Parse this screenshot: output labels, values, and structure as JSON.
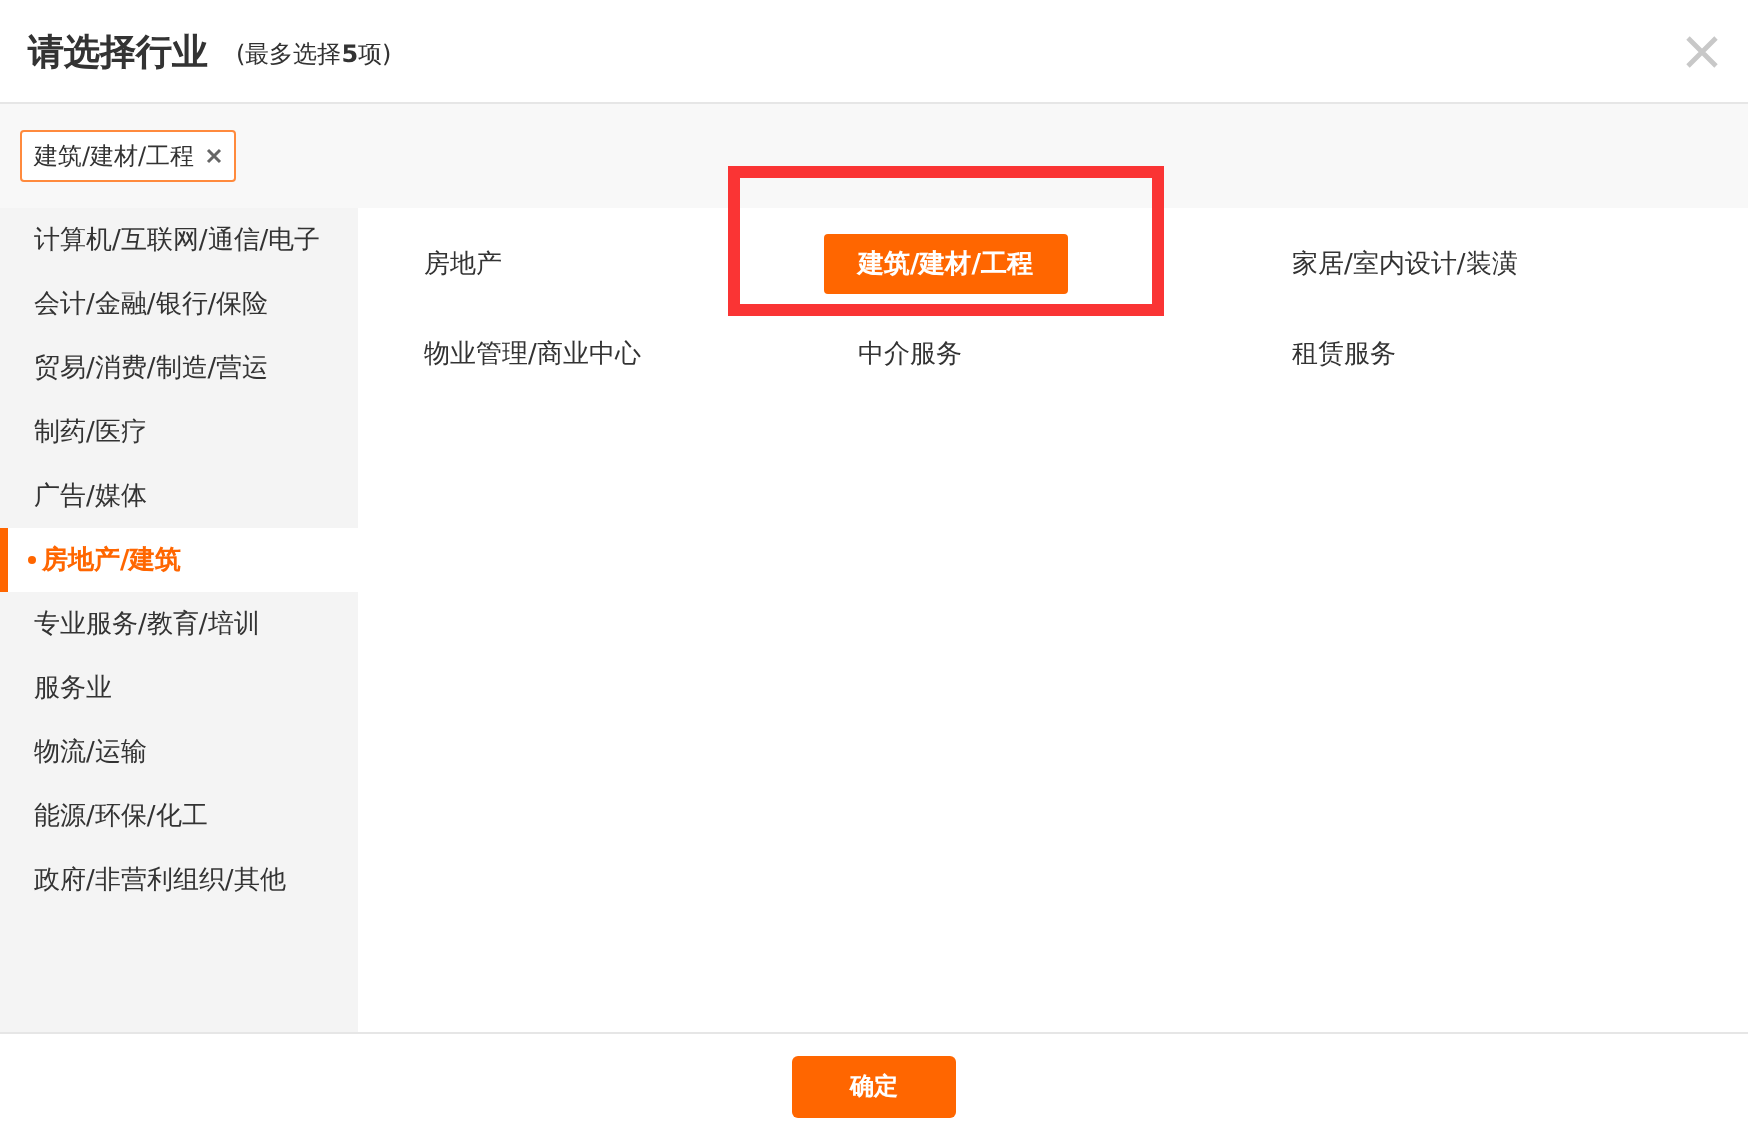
{
  "dialog": {
    "title": "请选择行业",
    "subtitle": "(最多选择**5**项)"
  },
  "chosen_tags": [
    {
      "label": "建筑/建材/工程"
    }
  ],
  "categories": [
    {
      "label": "计算机/互联网/通信/电子",
      "selected": false
    },
    {
      "label": "会计/金融/银行/保险",
      "selected": false
    },
    {
      "label": "贸易/消费/制造/营运",
      "selected": false
    },
    {
      "label": "制药/医疗",
      "selected": false
    },
    {
      "label": "广告/媒体",
      "selected": false
    },
    {
      "label": "房地产/建筑",
      "selected": true
    },
    {
      "label": "专业服务/教育/培训",
      "selected": false
    },
    {
      "label": "服务业",
      "selected": false
    },
    {
      "label": "物流/运输",
      "selected": false
    },
    {
      "label": "能源/环保/化工",
      "selected": false
    },
    {
      "label": "政府/非营利组织/其他",
      "selected": false
    }
  ],
  "options": [
    {
      "label": "房地产",
      "selected": false
    },
    {
      "label": "建筑/建材/工程",
      "selected": true
    },
    {
      "label": "家居/室内设计/装潢",
      "selected": false
    },
    {
      "label": "物业管理/商业中心",
      "selected": false
    },
    {
      "label": "中介服务",
      "selected": false
    },
    {
      "label": "租赁服务",
      "selected": false
    }
  ],
  "confirm_button": "确定"
}
